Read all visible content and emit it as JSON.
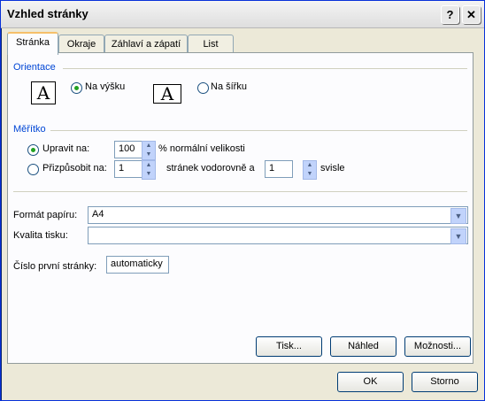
{
  "window": {
    "title": "Vzhled stránky",
    "help_glyph": "?",
    "close_glyph": "✕"
  },
  "tabs": [
    "Stránka",
    "Okraje",
    "Záhlaví a zápatí",
    "List"
  ],
  "orientation": {
    "group_label": "Orientace",
    "portrait_icon": "A",
    "portrait_label": "Na výšku",
    "landscape_icon": "A",
    "landscape_label": "Na šířku"
  },
  "scaling": {
    "group_label": "Měřítko",
    "adjust_label": "Upravit na:",
    "adjust_value": "100",
    "adjust_suffix": "% normální velikosti",
    "fit_label": "Přizpůsobit na:",
    "fit_wide_value": "1",
    "fit_wide_suffix": "stránek vodorovně a",
    "fit_tall_value": "1",
    "fit_tall_suffix": "svisle"
  },
  "paper": {
    "label": "Formát papíru:",
    "value": "A4"
  },
  "quality": {
    "label": "Kvalita tisku:",
    "value": ""
  },
  "first_page": {
    "label": "Číslo první stránky:",
    "value": "automaticky"
  },
  "panel_buttons": {
    "print": "Tisk...",
    "preview": "Náhled",
    "options": "Možnosti..."
  },
  "dialog_buttons": {
    "ok": "OK",
    "cancel": "Storno"
  },
  "colors": {
    "group_label": "#0046d5",
    "radio_dot": "#21a121",
    "tab_highlight": "#f6c06a"
  }
}
